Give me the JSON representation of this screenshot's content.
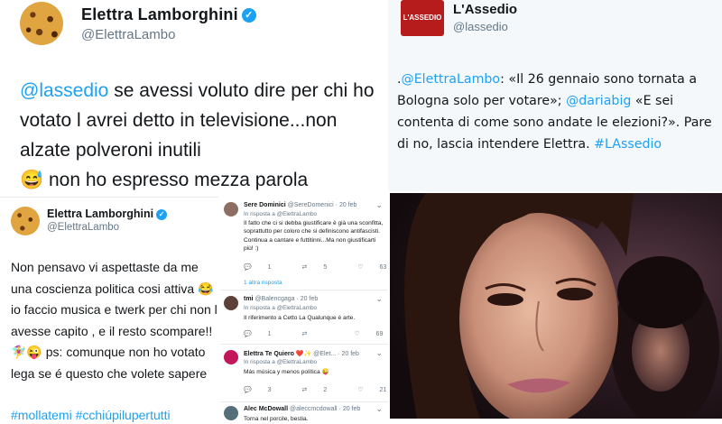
{
  "tweet_main": {
    "name": "Elettra Lamborghini",
    "handle": "@ElettraLambo",
    "mention": "@lassedio",
    "text": " se avessi voluto dire per chi ho votato l avrei detto in televisione...non alzate polveroni inutili",
    "emoji": "😅",
    "text_end": " non ho espresso mezza parola"
  },
  "tweet_assedio": {
    "name": "L'Assedio",
    "handle": "@lassedio",
    "logo_text": "L'ASSEDIO",
    "dot": ".",
    "mention1": "@ElettraLambo",
    "text1": ": «Il 26 gennaio sono tornata a Bologna solo per votare»; ",
    "mention2": "@dariabig",
    "text2": " «E sei contenta di come sono andate le elezioni?». Pare di no, lascia intendere Elettra. ",
    "hashtag": "#LAssedio"
  },
  "tweet_second": {
    "name": "Elettra Lamborghini",
    "handle": "@ElettraLambo",
    "text": "Non pensavo vi aspettaste da me una coscienza politica cosi attiva 😂 io faccio musica e twerk per chi non l avesse capito , e il resto scompare!! 🧚‍♀️😜 ps: comunque non ho votato lega se é questo che volete sapere",
    "hashtags": "#mollatemi #cchiúpilupertutti"
  },
  "replies": [
    {
      "name": "Sere Dominici",
      "handle": "@SereDomenici",
      "date": "· 20 feb",
      "replying": "In risposta a @ElettraLambo",
      "text": "Il fatto che ci si debba giustificare è già una sconfitta, soprattutto per coloro che si definiscono antifascisti. Continua a cantare e futtitinni...Ma non giustificarti più! :)",
      "replies": "1",
      "retweets": "5",
      "likes": "63",
      "thread": "1 altra risposta",
      "avatar_color": "#8d6e63"
    },
    {
      "name": "tmi",
      "handle": "@Balencgaga",
      "date": "· 20 feb",
      "replying": "In risposta a @ElettraLambo",
      "text": "Il riferimento a Cetto La Qualunque è arte.",
      "replies": "1",
      "retweets": "",
      "likes": "69",
      "thread": "",
      "avatar_color": "#5d4037"
    },
    {
      "name": "Elettra Te Quiero ❤️✨",
      "handle": "@Elet...",
      "date": "· 20 feb",
      "replying": "In risposta a @ElettraLambo",
      "text": "Más música y menos política 😜",
      "replies": "3",
      "retweets": "2",
      "likes": "21",
      "thread": "",
      "avatar_color": "#c2185b"
    },
    {
      "name": "Alec McDowall",
      "handle": "@aleccmcdowall",
      "date": "· 20 feb",
      "replying": "",
      "text": "Torna nel porcile, bestia.",
      "replies": "",
      "retweets": "",
      "likes": "",
      "thread": "",
      "avatar_color": "#546e7a"
    }
  ],
  "icons": {
    "verified": "✓",
    "more": "⌄",
    "reply": "💬",
    "retweet": "⇄",
    "like": "♡"
  }
}
